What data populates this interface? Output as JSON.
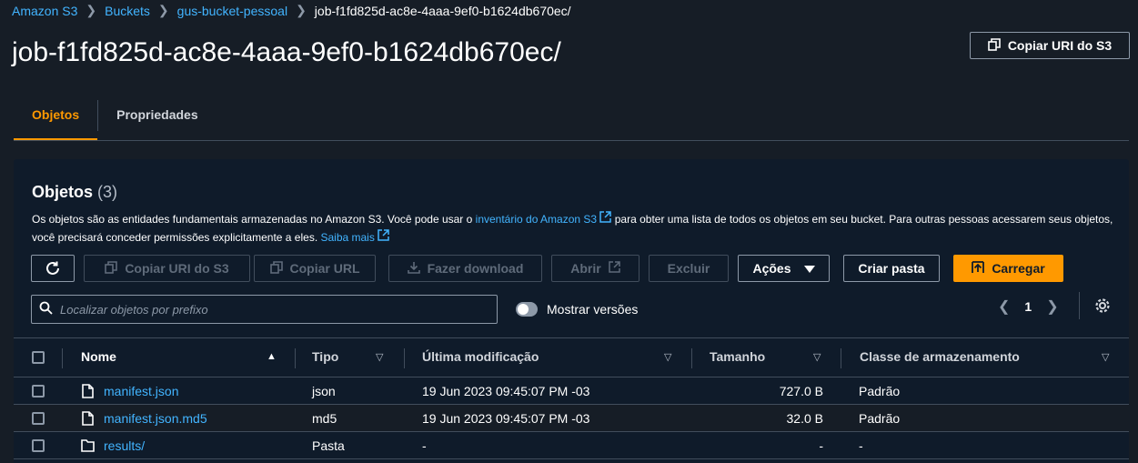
{
  "breadcrumb": {
    "items": [
      "Amazon S3",
      "Buckets",
      "gus-bucket-pessoal"
    ],
    "current": "job-f1fd825d-ac8e-4aaa-9ef0-b1624db670ec/"
  },
  "page": {
    "title": "job-f1fd825d-ac8e-4aaa-9ef0-b1624db670ec/",
    "copy_uri_label": "Copiar URI do S3"
  },
  "tabs": [
    "Objetos",
    "Propriedades"
  ],
  "panel": {
    "title": "Objetos",
    "count": "(3)",
    "desc_part1": "Os objetos são as entidades fundamentais armazenadas no Amazon S3. Você pode usar o ",
    "desc_link1": "inventário do Amazon S3",
    "desc_part2": " para obter uma lista de todos os objetos em seu bucket. Para outras pessoas acessarem seus objetos, você precisará conceder permissões explicitamente a eles. ",
    "desc_link2": "Saiba mais"
  },
  "toolbar": {
    "copy_uri": "Copiar URI do S3",
    "copy_url": "Copiar URL",
    "download": "Fazer download",
    "open": "Abrir",
    "delete": "Excluir",
    "actions": "Ações",
    "create_folder": "Criar pasta",
    "upload": "Carregar"
  },
  "search": {
    "placeholder": "Localizar objetos por prefixo"
  },
  "versions_toggle": {
    "label": "Mostrar versões",
    "on": false
  },
  "pagination": {
    "page": "1"
  },
  "table": {
    "headers": {
      "name": "Nome",
      "type": "Tipo",
      "modified": "Última modificação",
      "size": "Tamanho",
      "storage_class": "Classe de armazenamento"
    },
    "rows": [
      {
        "name": "manifest.json",
        "icon": "file-icon",
        "type": "json",
        "modified": "19 Jun 2023 09:45:07 PM -03",
        "size": "727.0 B",
        "storage_class": "Padrão"
      },
      {
        "name": "manifest.json.md5",
        "icon": "file-icon",
        "type": "md5",
        "modified": "19 Jun 2023 09:45:07 PM -03",
        "size": "32.0 B",
        "storage_class": "Padrão"
      },
      {
        "name": "results/",
        "icon": "folder-icon",
        "type": "Pasta",
        "modified": "-",
        "size": "-",
        "storage_class": "-"
      }
    ]
  },
  "colors": {
    "accent": "#ff9900",
    "link": "#42b4ff",
    "background": "#161d26",
    "panel": "#0f1b2a"
  }
}
